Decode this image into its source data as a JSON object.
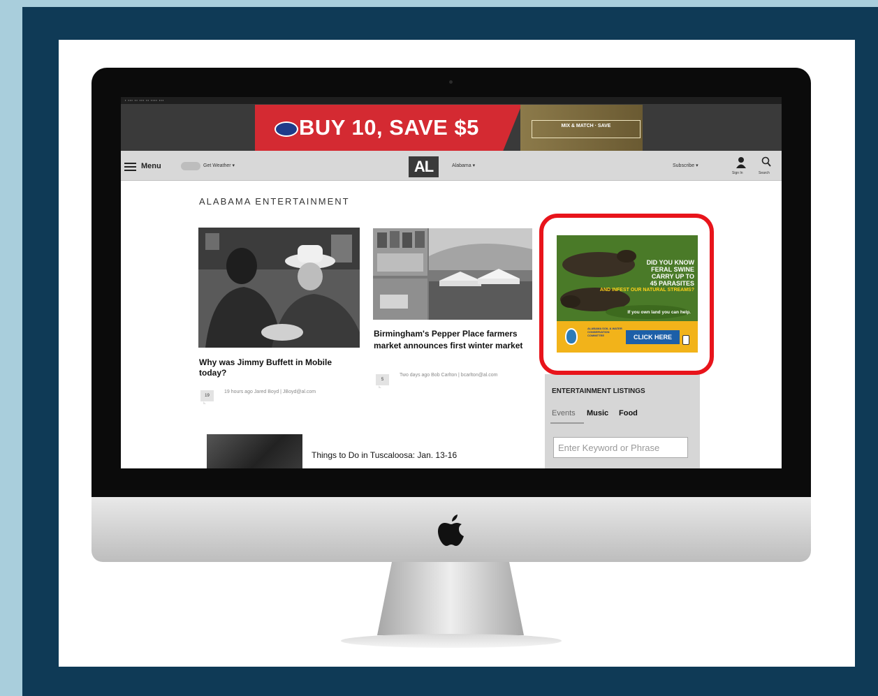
{
  "ad_banner": {
    "headline": "BUY 10, SAVE $5",
    "side_text": "MIX & MATCH · SAVE"
  },
  "nav": {
    "menu_label": "Menu",
    "weather_label": "Get Weather ▾",
    "logo": "AL",
    "region_label": "Alabama ▾",
    "subscribe_label": "Subscribe ▾",
    "signin_label": "Sign In",
    "search_label": "Search"
  },
  "page": {
    "section_title": "ALABAMA ENTERTAINMENT"
  },
  "articles": [
    {
      "headline": "Why was Jimmy Buffett in Mobile today?",
      "comments": "19",
      "meta": "19 hours ago Jared Boyd | JBoyd@al.com"
    },
    {
      "headline": "Birmingham's Pepper Place farmers market announces first winter market",
      "comments": "5",
      "meta": "Two days ago Bob Carlton | bcarlton@al.com"
    },
    {
      "headline": "Things to Do in Tuscaloosa: Jan. 13-16"
    }
  ],
  "side_ad": {
    "line1": "DID YOU KNOW",
    "line2": "FERAL SWINE",
    "line3": "CARRY UP TO",
    "line4": "45 PARASITES",
    "line5": "AND INFEST OUR NATURAL STREAMS?",
    "subline": "If you own land you can help.",
    "org": "ALABAMA SOIL & WATER CONSERVATION COMMITTEE",
    "cta": "CLICK HERE"
  },
  "listings": {
    "title": "ENTERTAINMENT LISTINGS",
    "tabs": [
      "Events",
      "Music",
      "Food"
    ],
    "search_placeholder": "Enter Keyword or Phrase"
  },
  "colors": {
    "background_blue": "#0f3a56",
    "highlight_red": "#e8141b",
    "ad_red": "#d42a32",
    "cta_blue": "#1c5fa8"
  },
  "icons": [
    "apple-logo-icon",
    "hamburger-menu-icon",
    "weather-cloud-icon",
    "person-icon",
    "search-icon",
    "cursor-hand-icon"
  ]
}
